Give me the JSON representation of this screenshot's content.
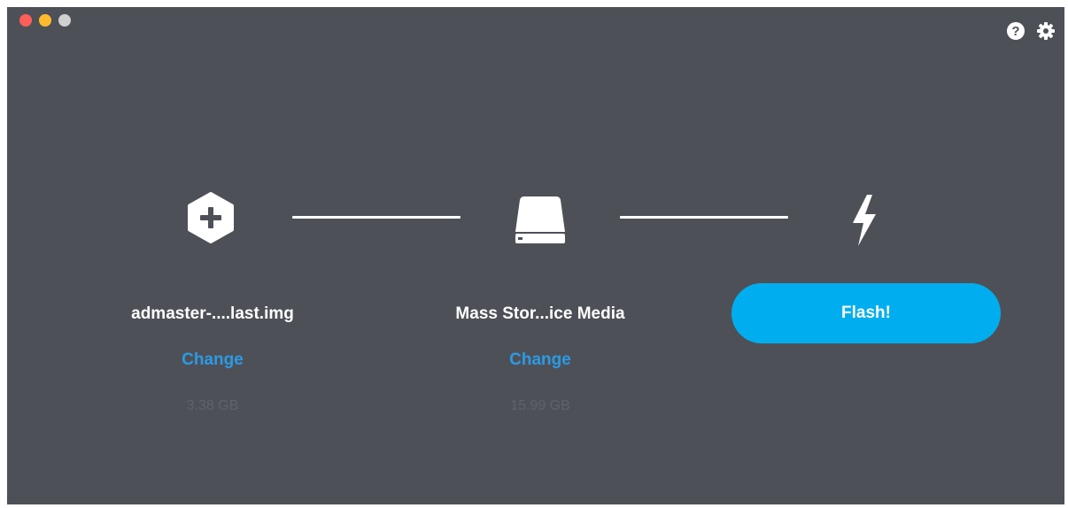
{
  "window": {
    "controls": [
      "close",
      "minimize",
      "maximize"
    ]
  },
  "toolbar": {
    "icons": [
      "help-icon",
      "settings-icon"
    ]
  },
  "steps": {
    "image": {
      "icon": "hexagon-plus-icon",
      "title": "admaster-....last.img",
      "change_label": "Change",
      "size": "3.38 GB"
    },
    "drive": {
      "icon": "drive-icon",
      "title": "Mass Stor...ice Media",
      "change_label": "Change",
      "size": "15.99 GB"
    },
    "flash": {
      "icon": "lightning-icon",
      "button_label": "Flash!"
    }
  },
  "colors": {
    "background": "#4e5058",
    "accent": "#00aeef",
    "link": "#2a9be4",
    "muted": "#5f626a"
  }
}
